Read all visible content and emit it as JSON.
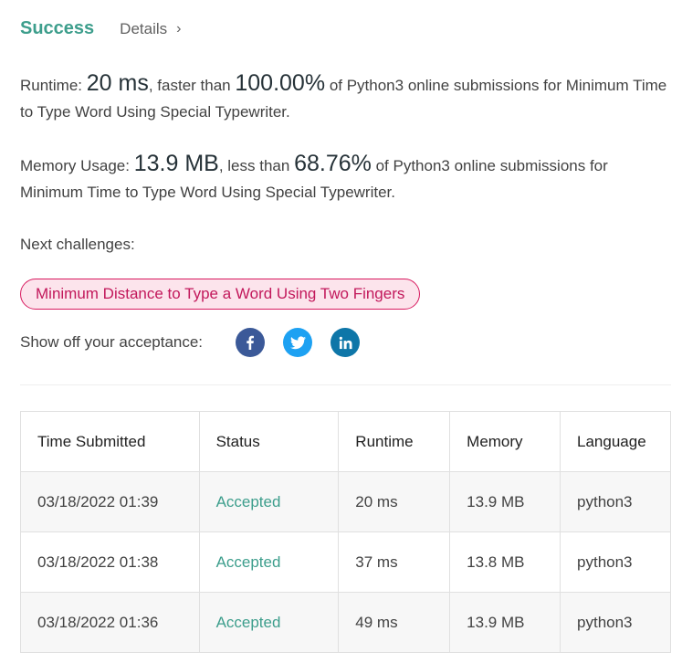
{
  "header": {
    "status": "Success",
    "details_label": "Details"
  },
  "runtime": {
    "label": "Runtime:",
    "value": "20 ms",
    "comparison": ", faster than",
    "percent": "100.00%",
    "suffix": "of Python3 online submissions for Minimum Time to Type Word Using Special Typewriter."
  },
  "memory": {
    "label": "Memory Usage:",
    "value": "13.9 MB",
    "comparison": ", less than",
    "percent": "68.76%",
    "suffix": "of Python3 online submissions for Minimum Time to Type Word Using Special Typewriter."
  },
  "next": {
    "label": "Next challenges:",
    "challenges": [
      "Minimum Distance to Type a Word Using Two Fingers"
    ]
  },
  "share": {
    "label": "Show off your acceptance:",
    "icons": [
      "facebook-icon",
      "twitter-icon",
      "linkedin-icon"
    ]
  },
  "colors": {
    "accent": "#3d9e8c",
    "pill_border": "#d81b60",
    "pill_bg": "#fce4ec",
    "facebook": "#3b5998",
    "twitter": "#1da1f2",
    "linkedin": "#0e76a8"
  },
  "table": {
    "headers": [
      "Time Submitted",
      "Status",
      "Runtime",
      "Memory",
      "Language"
    ],
    "rows": [
      [
        "03/18/2022 01:39",
        "Accepted",
        "20 ms",
        "13.9 MB",
        "python3"
      ],
      [
        "03/18/2022 01:38",
        "Accepted",
        "37 ms",
        "13.8 MB",
        "python3"
      ],
      [
        "03/18/2022 01:36",
        "Accepted",
        "49 ms",
        "13.9 MB",
        "python3"
      ]
    ]
  }
}
